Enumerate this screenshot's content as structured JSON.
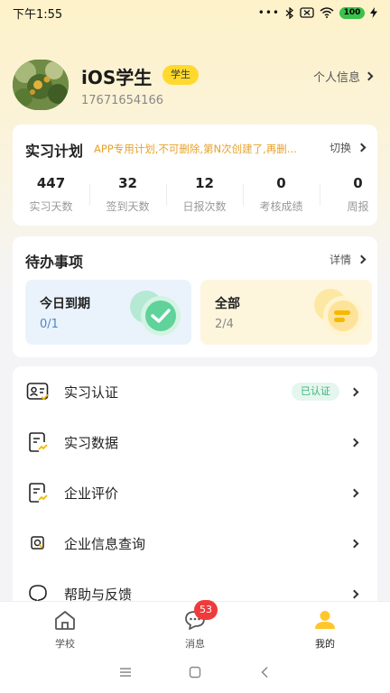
{
  "status_bar": {
    "time": "下午1:55",
    "battery": "100"
  },
  "profile": {
    "name": "iOS学生",
    "role": "学生",
    "phone": "17671654166",
    "info_link": "个人信息"
  },
  "plan": {
    "title": "实习计划",
    "description": "APP专用计划,不可删除,第N次创建了,再删...",
    "switch_label": "切换",
    "stats": [
      {
        "value": "447",
        "label": "实习天数"
      },
      {
        "value": "32",
        "label": "签到天数"
      },
      {
        "value": "12",
        "label": "日报次数"
      },
      {
        "value": "0",
        "label": "考核成绩"
      },
      {
        "value": "0",
        "label": "周报"
      }
    ]
  },
  "todo": {
    "title": "待办事项",
    "detail_label": "详情",
    "due_today": {
      "title": "今日到期",
      "count": "0/1"
    },
    "all": {
      "title": "全部",
      "count": "2/4"
    }
  },
  "menu": {
    "items": [
      {
        "label": "实习认证",
        "badge": "已认证",
        "icon": "id-card-icon"
      },
      {
        "label": "实习数据",
        "icon": "data-doc-icon"
      },
      {
        "label": "企业评价",
        "icon": "review-doc-icon"
      },
      {
        "label": "企业信息查询",
        "icon": "search-doc-icon"
      },
      {
        "label": "帮助与反馈",
        "icon": "help-bubble-icon"
      }
    ]
  },
  "tabbar": {
    "tabs": [
      {
        "label": "学校",
        "icon": "home-icon"
      },
      {
        "label": "消息",
        "icon": "message-icon",
        "badge": "53"
      },
      {
        "label": "我的",
        "icon": "user-icon"
      }
    ]
  },
  "colors": {
    "accent": "#ffd92e",
    "plan_desc": "#e7a12c",
    "verified_bg": "#e4f6ee",
    "verified_text": "#3bb37a",
    "badge_red": "#ef3b3b"
  }
}
